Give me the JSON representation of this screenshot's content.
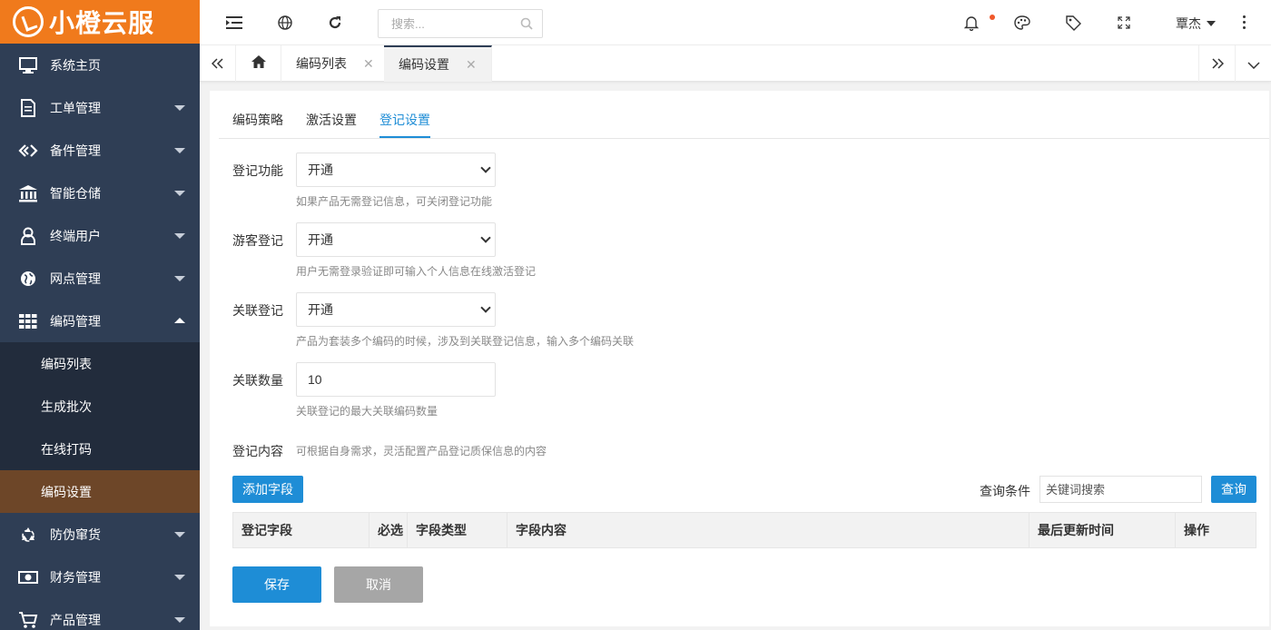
{
  "brand": {
    "name": "小橙云服"
  },
  "sidebar": {
    "items": [
      {
        "label": "系统主页",
        "icon": "monitor-icon"
      },
      {
        "label": "工单管理",
        "icon": "document-icon"
      },
      {
        "label": "备件管理",
        "icon": "link-icon"
      },
      {
        "label": "智能仓储",
        "icon": "bank-icon"
      },
      {
        "label": "终端用户",
        "icon": "user-icon"
      },
      {
        "label": "网点管理",
        "icon": "globe-icon"
      },
      {
        "label": "编码管理",
        "icon": "grid-icon"
      },
      {
        "label": "防伪窜货",
        "icon": "recycle-icon"
      },
      {
        "label": "财务管理",
        "icon": "money-icon"
      },
      {
        "label": "产品管理",
        "icon": "cart-icon"
      }
    ],
    "sub_items": [
      {
        "label": "编码列表"
      },
      {
        "label": "生成批次"
      },
      {
        "label": "在线打码"
      },
      {
        "label": "编码设置"
      }
    ]
  },
  "topbar": {
    "search_placeholder": "搜索...",
    "user": "覃杰"
  },
  "page_tabs": [
    {
      "label": "编码列表"
    },
    {
      "label": "编码设置"
    }
  ],
  "sub_tabs": [
    {
      "label": "编码策略"
    },
    {
      "label": "激活设置"
    },
    {
      "label": "登记设置"
    }
  ],
  "form": {
    "register_function": {
      "label": "登记功能",
      "value": "开通",
      "hint": "如果产品无需登记信息，可关闭登记功能"
    },
    "guest_register": {
      "label": "游客登记",
      "value": "开通",
      "hint": "用户无需登录验证即可输入个人信息在线激活登记"
    },
    "linked_register": {
      "label": "关联登记",
      "value": "开通",
      "hint": "产品为套装多个编码的时候，涉及到关联登记信息，输入多个编码关联"
    },
    "linked_count": {
      "label": "关联数量",
      "value": "10",
      "hint": "关联登记的最大关联编码数量"
    },
    "register_content": {
      "label": "登记内容",
      "hint": "可根据自身需求，灵活配置产品登记质保信息的内容"
    }
  },
  "toolbar": {
    "add_field": "添加字段",
    "query_label": "查询条件",
    "query_placeholder": "关键词搜索",
    "query_button": "查询"
  },
  "table": {
    "columns": [
      "登记字段",
      "必选",
      "字段类型",
      "字段内容",
      "最后更新时间",
      "操作"
    ]
  },
  "actions": {
    "save": "保存",
    "cancel": "取消"
  },
  "colors": {
    "brand_orange": "#f07a1c",
    "sidebar_bg": "#2f3e55",
    "active_sub_item": "#6d4628",
    "primary_blue": "#1e8dd6",
    "notification_dot": "#f0582a"
  }
}
